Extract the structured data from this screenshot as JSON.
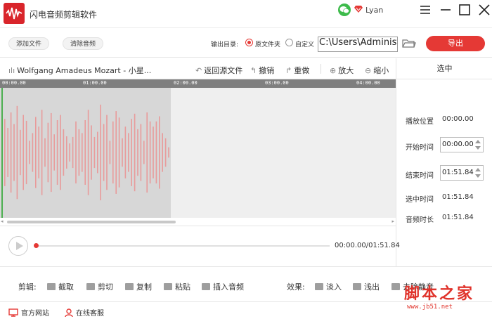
{
  "app": {
    "title": "闪电音频剪辑软件",
    "user": "Lyan"
  },
  "toolbar": {
    "add_file": "添加文件",
    "clear_audio": "清除音频",
    "output_dir_label": "输出目录:",
    "option_source": "原文件夹",
    "option_custom": "自定义",
    "path_value": "C:\\Users\\Administrator",
    "export": "导出"
  },
  "editor": {
    "track_name": "Wolfgang Amadeus Mozart - 小星...",
    "back_to_source": "返回源文件",
    "undo": "撤销",
    "redo": "重做",
    "zoom_in": "放大",
    "zoom_out": "缩小",
    "ruler_ticks": [
      "00:00.00",
      "01:00.00",
      "02:00.00",
      "03:00.00",
      "04:00.00"
    ]
  },
  "panel": {
    "header": "选中",
    "play_position_label": "播放位置",
    "play_position": "00:00.00",
    "start_time_label": "开始时间",
    "start_time": "00:00.00",
    "end_time_label": "结束时间",
    "end_time": "01:51.84",
    "selected_time_label": "选中时间",
    "selected_time": "01:51.84",
    "duration_label": "音频时长",
    "duration": "01:51.84"
  },
  "player": {
    "time": "00:00.00/01:51.84",
    "progress": 0
  },
  "edit": {
    "label": "剪辑:",
    "cut": "截取",
    "clip": "剪切",
    "copy": "复制",
    "paste": "粘贴",
    "insert_audio": "插入音频"
  },
  "effects": {
    "label": "效果:",
    "fade_in": "淡入",
    "fade_out": "浅出",
    "remove_silence": "去除静音"
  },
  "footer": {
    "website": "官方网站",
    "service": "在线客服"
  },
  "watermark": {
    "text": "脚本之家",
    "url": "www.jb51.net"
  },
  "colors": {
    "accent": "#e53935",
    "wave": "#e89b9b",
    "selection": "#d7d7d7"
  },
  "waveform": {
    "amplitudes": [
      0.52,
      0.38,
      0.62,
      0.44,
      0.72,
      0.35,
      0.58,
      0.49,
      0.18,
      0.3,
      0.55,
      0.4,
      0.66,
      0.22,
      0.46,
      0.61,
      0.28,
      0.5,
      0.58,
      0.36,
      0.25,
      0.14,
      0.24,
      0.48,
      0.36,
      0.3,
      0.5,
      0.66,
      0.42,
      0.24,
      0.32,
      0.74,
      0.44,
      0.58,
      0.18,
      0.48,
      0.64,
      0.54,
      0.22,
      0.4,
      0.3,
      0.52,
      0.6,
      0.36,
      0.44,
      0.18,
      0.62,
      0.48,
      0.4,
      0.48,
      0.56,
      0.3,
      0.22,
      0.08
    ]
  }
}
